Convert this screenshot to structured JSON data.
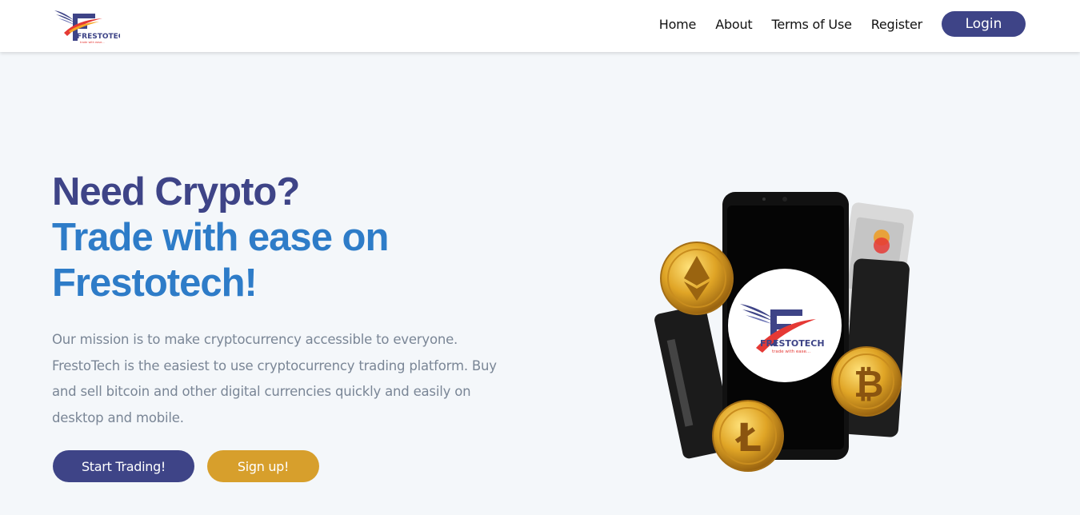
{
  "brand": {
    "name": "FRESTOTECH",
    "tagline": "trade with ease...",
    "colors": {
      "primary": "#3e4487",
      "accent_blue": "#2e7cc8",
      "gold": "#d79f2c",
      "red": "#e53935"
    }
  },
  "nav": {
    "links": [
      "Home",
      "About",
      "Terms of Use",
      "Register"
    ],
    "login_label": "Login"
  },
  "hero": {
    "title_line1": "Need Crypto?",
    "title_line2": "Trade with ease on Frestotech!",
    "description": "Our mission is to make cryptocurrency accessible to everyone. FrestoTech is the easiest to use cryptocurrency trading platform. Buy and sell bitcoin and other digital currencies quickly and easily on desktop and mobile.",
    "primary_button": "Start Trading!",
    "secondary_button": "Sign up!"
  },
  "illustration": {
    "coins": [
      "ethereum-coin",
      "bitcoin-coin",
      "litecoin-coin"
    ],
    "logo_text": "FRESTOTECH",
    "logo_tagline": "trade with ease..."
  }
}
